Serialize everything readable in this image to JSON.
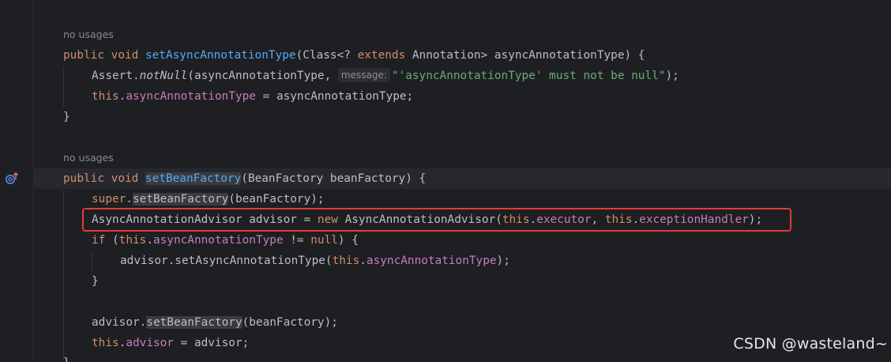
{
  "editor": {
    "hints": {
      "usages_1": "no usages",
      "usages_2": "no usages",
      "param_message": "message:"
    },
    "method1": {
      "sig_public": "public",
      "sig_void": "void",
      "sig_name": "setAsyncAnnotationType",
      "sig_params_a": "(Class<? ",
      "sig_extends": "extends",
      "sig_params_b": " Annotation> asyncAnnotationType) {",
      "assert_a": "Assert.",
      "assert_fn": "notNull",
      "assert_b": "(asyncAnnotationType, ",
      "assert_str": "\"'asyncAnnotationType' must not be null\"",
      "assert_c": ");",
      "assign_this": "this",
      "assign_dot": ".",
      "assign_field": "asyncAnnotationType",
      "assign_rest": " = asyncAnnotationType;",
      "close": "}"
    },
    "method2": {
      "sig_public": "public",
      "sig_void": "void",
      "sig_name": "setBeanFactory",
      "sig_params": "(BeanFactory beanFactory) {",
      "super_kw": "super",
      "super_dot": ".",
      "super_call": "setBeanFactory",
      "super_args": "(beanFactory);",
      "adv_decl": "AsyncAnnotationAdvisor advisor = ",
      "adv_new": "new",
      "adv_ctor": " AsyncAnnotationAdvisor(",
      "adv_this1": "this",
      "adv_dot1": ".",
      "adv_executor": "executor",
      "adv_comma": ", ",
      "adv_this2": "this",
      "adv_dot2": ".",
      "adv_handler": "exceptionHandler",
      "adv_end": ");",
      "if_kw": "if",
      "if_open": " (",
      "if_this": "this",
      "if_dot": ".",
      "if_field": "asyncAnnotationType",
      "if_neq": " != ",
      "if_null": "null",
      "if_close": ") {",
      "set_a": "advisor.setAsyncAnnotationType(",
      "set_this": "this",
      "set_dot": ".",
      "set_field": "asyncAnnotationType",
      "set_end": ");",
      "if_end": "}",
      "bf_a": "advisor.",
      "bf_call": "setBeanFactory",
      "bf_args": "(beanFactory);",
      "this_kw": "this",
      "this_dot": ".",
      "this_field": "advisor",
      "this_rest": " = advisor;",
      "close": "}"
    }
  },
  "watermark": "CSDN @wasteland~",
  "colors": {
    "background": "#1e1f22",
    "keyword": "#cf8e6d",
    "function": "#56a8f5",
    "field": "#c77dbb",
    "string": "#6aab73",
    "highlight_box": "#e53935"
  },
  "icons": {
    "gutter": "override-method-icon"
  }
}
